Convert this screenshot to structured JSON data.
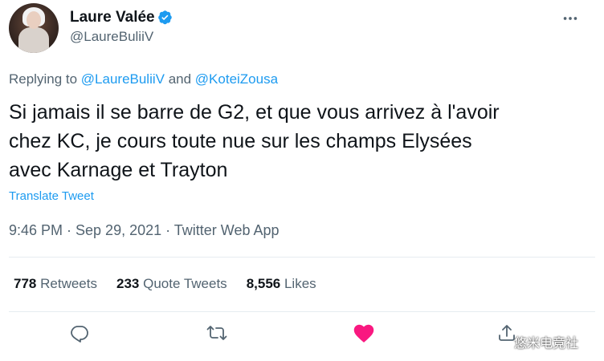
{
  "author": {
    "name": "Laure Valée",
    "handle": "@LaureBuliiV"
  },
  "reply": {
    "prefix": "Replying to ",
    "user1": "@LaureBuliiV",
    "conjunction": " and ",
    "user2": "@KoteiZousa"
  },
  "tweet": {
    "lines": [
      "Si jamais il se barre de G2, et que vous arrivez à l'avoir",
      "chez KC, je cours toute nue sur les champs Elysées",
      "avec Karnage et Trayton"
    ],
    "translate_label": "Translate Tweet",
    "meta": "9:46 PM · Sep 29, 2021 · Twitter Web App"
  },
  "stats": {
    "retweets_count": "778",
    "retweets_label": "Retweets",
    "quotes_count": "233",
    "quotes_label": "Quote Tweets",
    "likes_count": "8,556",
    "likes_label": "Likes"
  },
  "actions": {
    "reply_icon": "reply-icon",
    "retweet_icon": "retweet-icon",
    "like_icon": "heart-icon",
    "share_icon": "share-icon"
  },
  "watermark": "悠米电竞社",
  "colors": {
    "accent": "#1d9bf0",
    "like": "#f91880",
    "muted": "#536471"
  }
}
